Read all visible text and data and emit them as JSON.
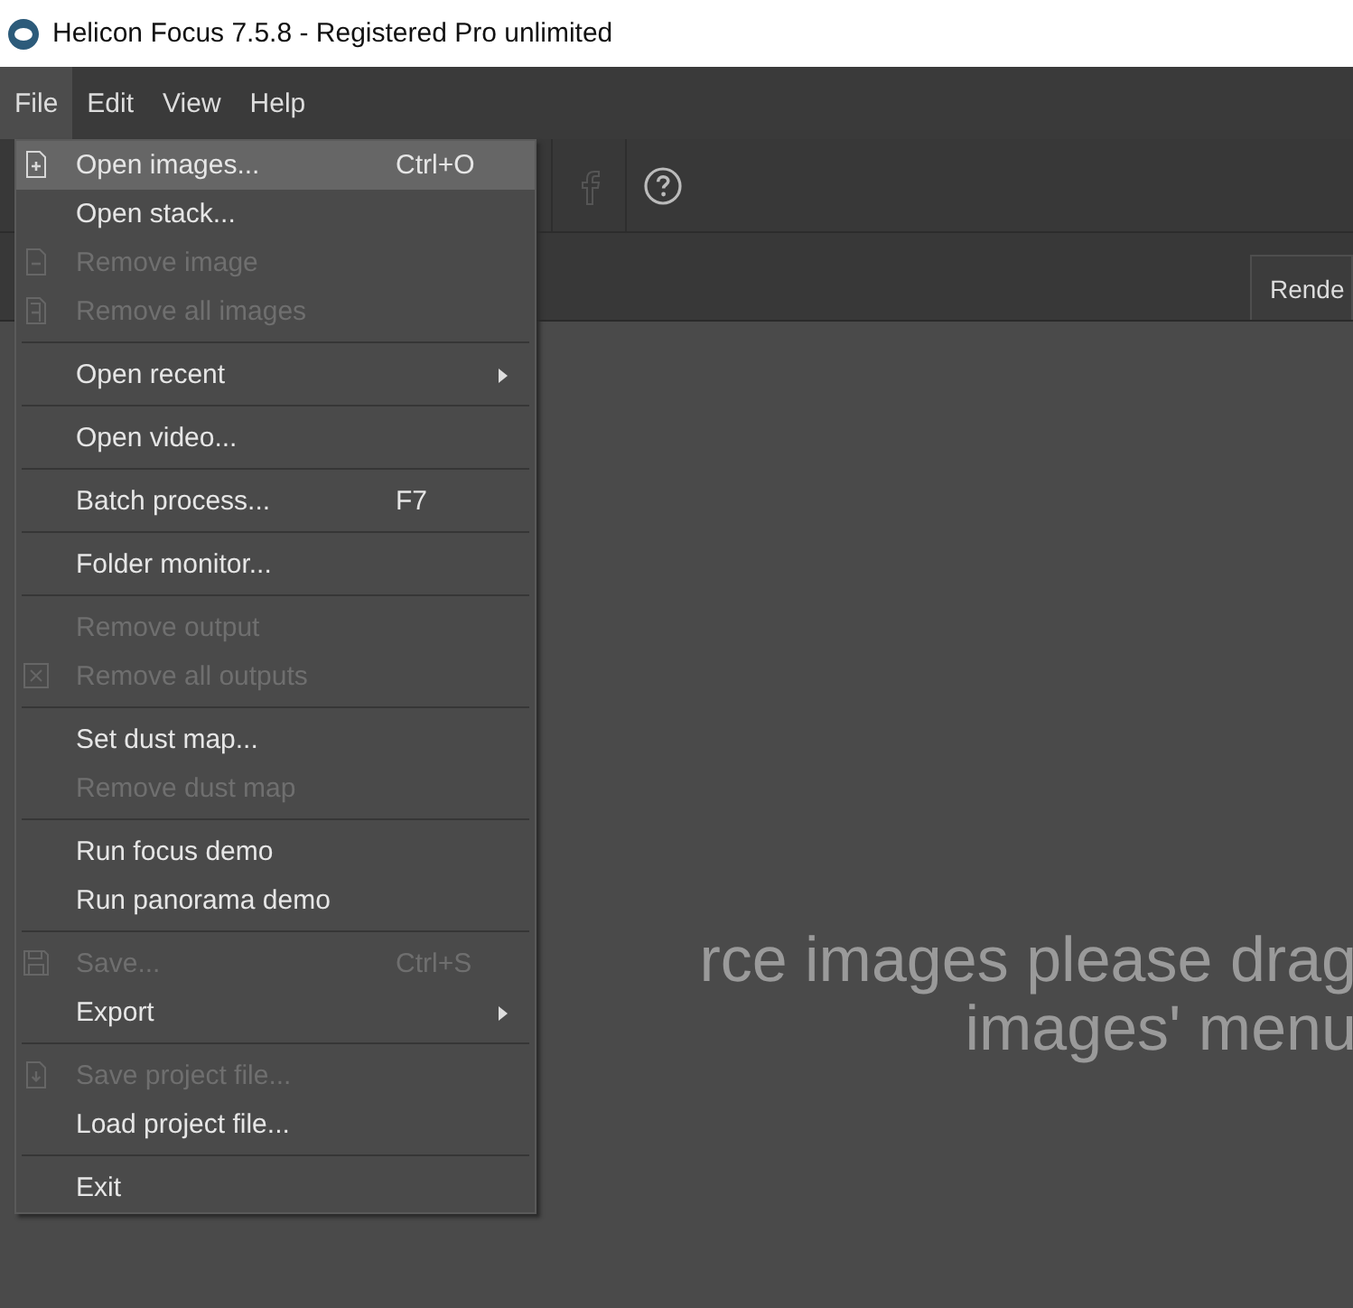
{
  "window": {
    "title": "Helicon Focus 7.5.8 - Registered Pro unlimited"
  },
  "menubar": [
    {
      "label": "File",
      "selected": true
    },
    {
      "label": "Edit",
      "selected": false
    },
    {
      "label": "View",
      "selected": false
    },
    {
      "label": "Help",
      "selected": false
    }
  ],
  "toolbar": [
    {
      "kind": "facebook",
      "disabled": true
    },
    {
      "kind": "help",
      "disabled": false
    }
  ],
  "tab": {
    "label": "Rende"
  },
  "drop_hint": [
    "rce images please drag",
    "images' menu"
  ],
  "file_menu": [
    {
      "kind": "item",
      "label": "Open images...",
      "shortcut": "Ctrl+O",
      "disabled": false,
      "selected": true
    },
    {
      "kind": "item",
      "label": "Open stack...",
      "disabled": false,
      "selected": false
    },
    {
      "kind": "item",
      "label": "Remove image",
      "disabled": true,
      "selected": false
    },
    {
      "kind": "item",
      "label": "Remove all images",
      "disabled": true,
      "selected": false
    },
    {
      "kind": "separator"
    },
    {
      "kind": "item",
      "label": "Open recent",
      "submenu": true,
      "disabled": false,
      "selected": false
    },
    {
      "kind": "separator"
    },
    {
      "kind": "item",
      "label": "Open video...",
      "disabled": false,
      "selected": false
    },
    {
      "kind": "separator"
    },
    {
      "kind": "item",
      "label": "Batch process...",
      "shortcut": "F7",
      "disabled": false,
      "selected": false
    },
    {
      "kind": "separator"
    },
    {
      "kind": "item",
      "label": "Folder monitor...",
      "disabled": false,
      "selected": false
    },
    {
      "kind": "separator"
    },
    {
      "kind": "item",
      "label": "Remove output",
      "disabled": true,
      "selected": false
    },
    {
      "kind": "item",
      "label": "Remove all outputs",
      "disabled": true,
      "selected": false
    },
    {
      "kind": "separator"
    },
    {
      "kind": "item",
      "label": "Set dust map...",
      "disabled": false,
      "selected": false
    },
    {
      "kind": "item",
      "label": "Remove dust map",
      "disabled": true,
      "selected": false
    },
    {
      "kind": "separator"
    },
    {
      "kind": "item",
      "label": "Run focus demo",
      "disabled": false,
      "selected": false
    },
    {
      "kind": "item",
      "label": "Run panorama demo",
      "disabled": false,
      "selected": false
    },
    {
      "kind": "separator"
    },
    {
      "kind": "item",
      "label": "Save...",
      "shortcut": "Ctrl+S",
      "disabled": true,
      "selected": false
    },
    {
      "kind": "item",
      "label": "Export",
      "submenu": true,
      "disabled": false,
      "selected": false
    },
    {
      "kind": "separator"
    },
    {
      "kind": "item",
      "label": "Save project file...",
      "disabled": true,
      "selected": false
    },
    {
      "kind": "item",
      "label": "Load project file...",
      "disabled": false,
      "selected": false
    },
    {
      "kind": "separator"
    },
    {
      "kind": "item",
      "label": "Exit",
      "disabled": false,
      "selected": false
    }
  ]
}
